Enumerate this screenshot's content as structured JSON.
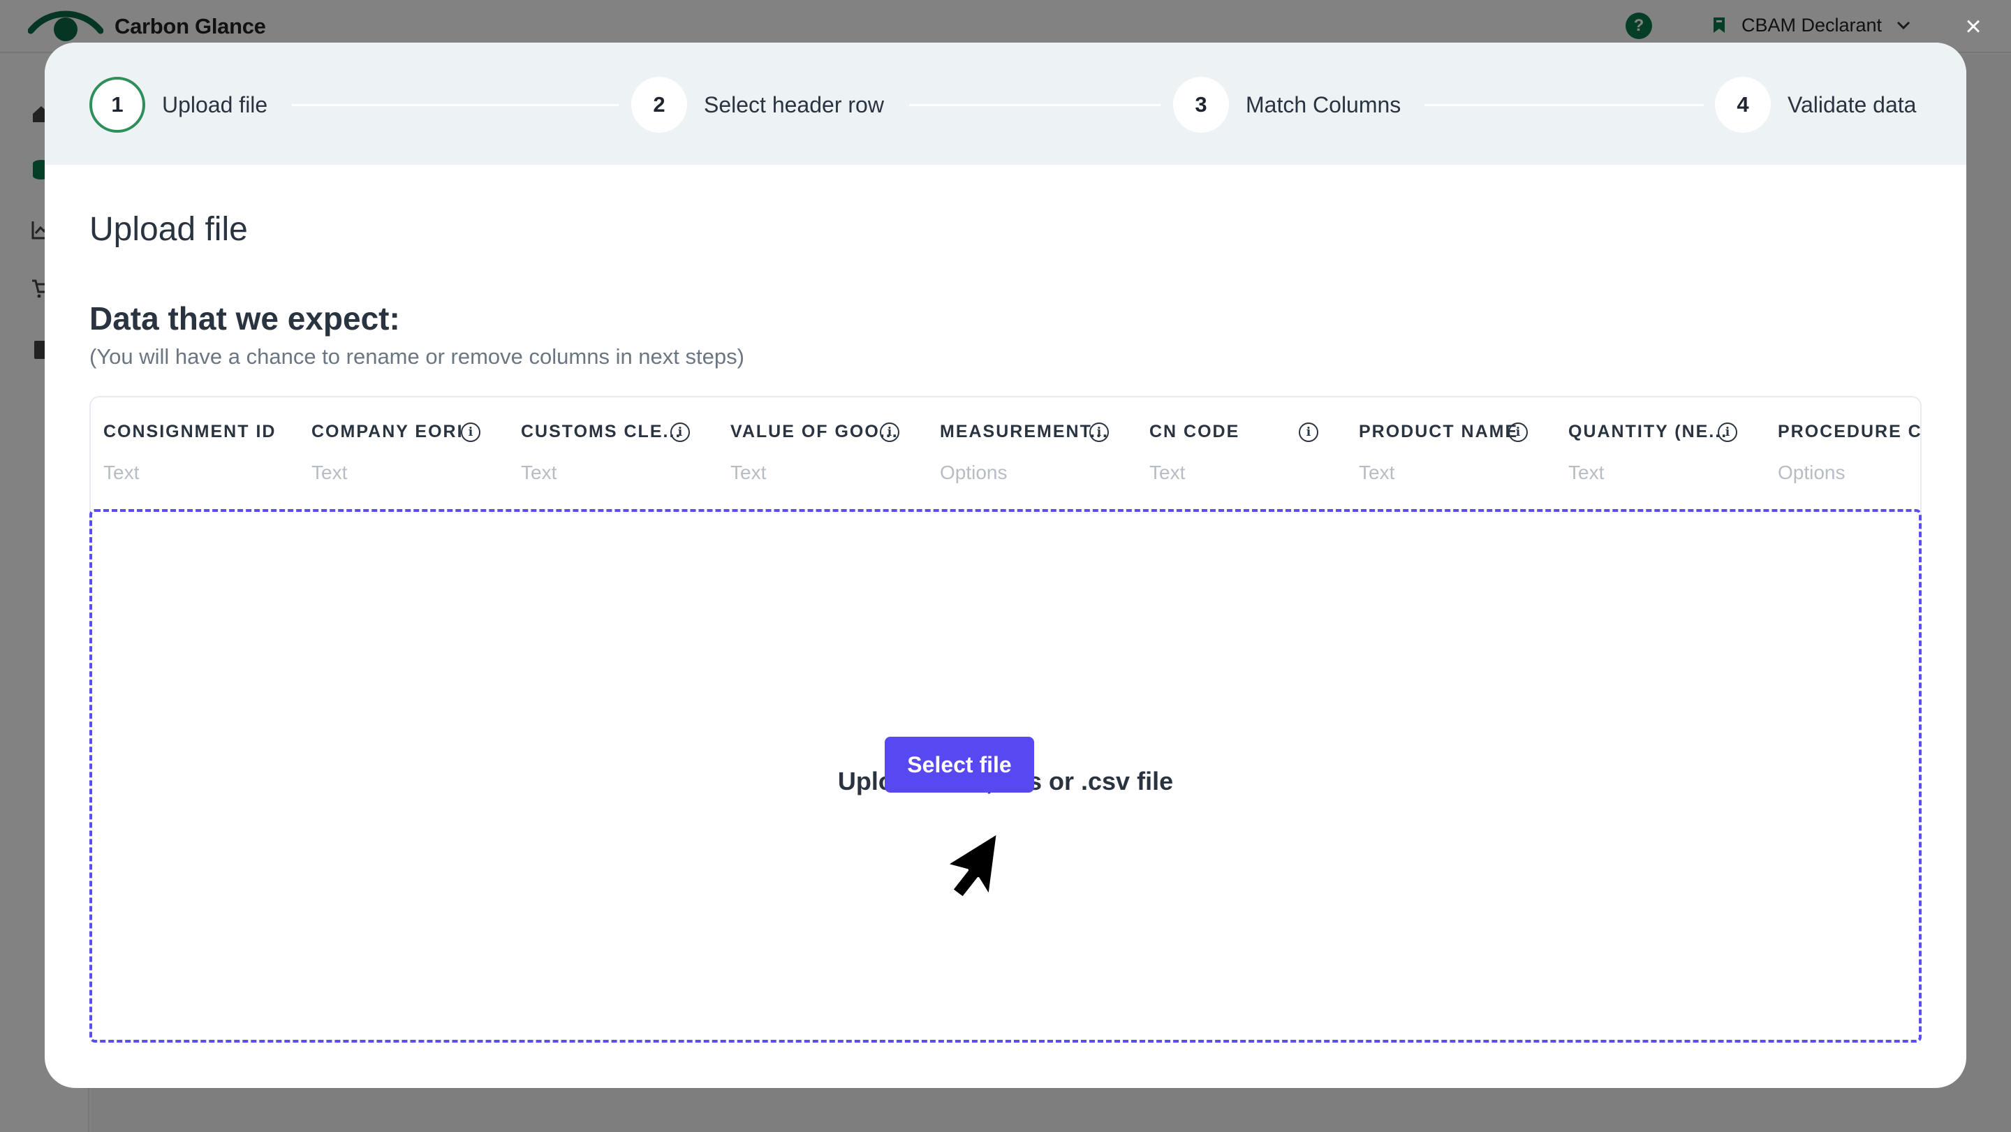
{
  "app": {
    "brand": "Carbon Glance",
    "brand_color": "#0b6b45",
    "help_icon": "?",
    "user_role": "CBAM Declarant"
  },
  "modal": {
    "close_icon": "×",
    "steps": [
      {
        "number": "1",
        "label": "Upload file",
        "active": true
      },
      {
        "number": "2",
        "label": "Select header row",
        "active": false
      },
      {
        "number": "3",
        "label": "Match Columns",
        "active": false
      },
      {
        "number": "4",
        "label": "Validate data",
        "active": false
      }
    ],
    "title": "Upload file",
    "expect_title": "Data that we expect:",
    "expect_subtitle": "(You will have a chance to rename or remove columns in next steps)",
    "columns": [
      {
        "name": "CONSIGNMENT ID",
        "type": "Text",
        "info": false
      },
      {
        "name": "COMPANY EORI",
        "type": "Text",
        "info": true
      },
      {
        "name": "CUSTOMS CLE...",
        "type": "Text",
        "info": true
      },
      {
        "name": "VALUE OF GOO...",
        "type": "Text",
        "info": true
      },
      {
        "name": "MEASUREMENT...",
        "type": "Options",
        "info": true
      },
      {
        "name": "CN CODE",
        "type": "Text",
        "info": true
      },
      {
        "name": "PRODUCT NAME",
        "type": "Text",
        "info": true
      },
      {
        "name": "QUANTITY (NE...",
        "type": "Text",
        "info": true
      },
      {
        "name": "PROCEDURE CO",
        "type": "Options",
        "info": false
      }
    ],
    "dropzone": {
      "label": "Upload .xlsx, .xls or .csv file",
      "button": "Select file",
      "accent": "#5848f2"
    }
  }
}
